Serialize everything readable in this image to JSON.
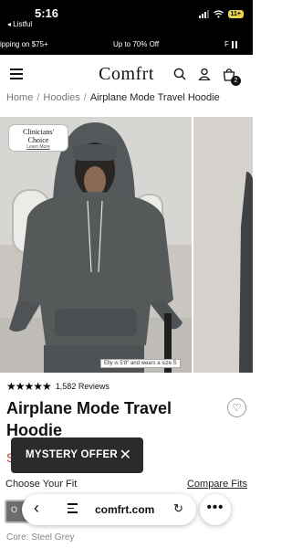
{
  "status_bar": {
    "time": "5:16",
    "back_app": "◂ Listful",
    "battery": "11+"
  },
  "promo": {
    "left": "ipping on $75+",
    "center": "Up to 70% Off",
    "right": "F"
  },
  "header": {
    "logo": "Comfrt",
    "cart_count": "2"
  },
  "breadcrumb": {
    "home": "Home",
    "sep": "/",
    "category": "Hoodies",
    "current": "Airplane Mode Travel Hoodie"
  },
  "badge": {
    "line1": "Clinicians'",
    "line2": "Choice",
    "link": "Learn More"
  },
  "image": {
    "caption": "Elly is 5'8\" and wears a size S"
  },
  "product": {
    "rating_stars": "★★★★★",
    "rating": 5,
    "reviews": "1,582 Reviews",
    "title": "Airplane Mode Travel Hoodie",
    "price": "S"
  },
  "offer": {
    "label": "MYSTERY OFFER",
    "close": "✕"
  },
  "fit": {
    "label": "Choose Your Fit",
    "compare": "Compare Fits"
  },
  "swatch": {
    "first": "O"
  },
  "color": {
    "label": "Core: Steel Grey"
  },
  "browser": {
    "url": "comfrt.com",
    "back": "‹",
    "reload": "↻",
    "more": "•••"
  },
  "colors": {
    "accent": "#000000",
    "price": "#c0392b",
    "offer_bg": "#2b2b2b",
    "hoodie": "#55595a"
  }
}
